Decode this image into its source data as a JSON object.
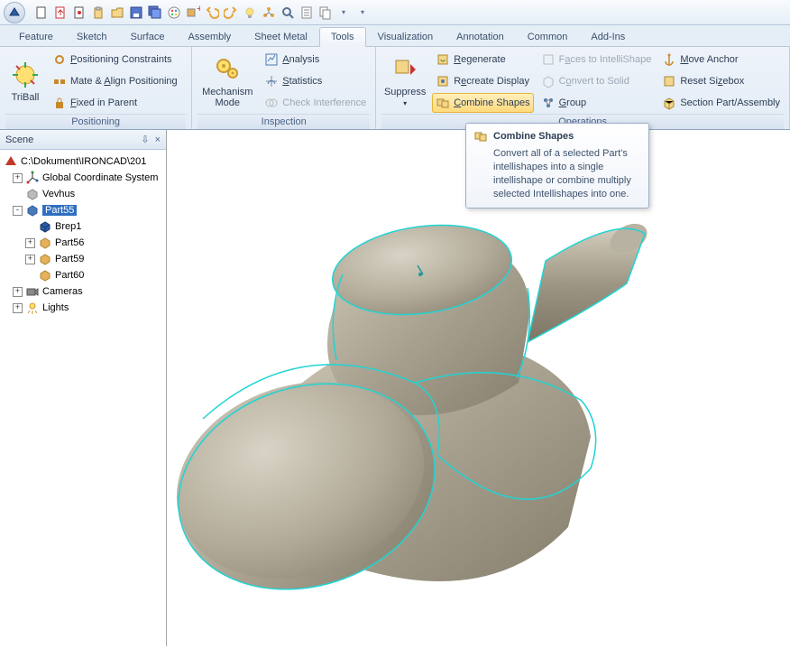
{
  "qat_icons": [
    "new",
    "open-red",
    "import",
    "clipboard",
    "folder",
    "save",
    "save-all",
    "palette",
    "block-plus",
    "undo",
    "redo",
    "bulb",
    "tree-icon",
    "find",
    "doc",
    "copy"
  ],
  "tabs": [
    "Feature",
    "Sketch",
    "Surface",
    "Assembly",
    "Sheet Metal",
    "Tools",
    "Visualization",
    "Annotation",
    "Common",
    "Add-Ins"
  ],
  "active_tab": "Tools",
  "ribbon": {
    "triball_label": "TriBall",
    "positioning": {
      "label": "Positioning",
      "items": [
        "Positioning Constraints",
        "Mate & Align Positioning",
        "Fixed in Parent"
      ]
    },
    "inspection": {
      "mechanism_label": "Mechanism Mode",
      "label": "Inspection",
      "items": [
        "Analysis",
        "Statistics",
        "Check Interference"
      ]
    },
    "suppress_label": "Suppress",
    "operations": {
      "label": "Operations",
      "col1": [
        "Regenerate",
        "Recreate Display",
        "Combine Shapes"
      ],
      "col2": [
        "Faces to IntelliShape",
        "Convert to Solid",
        "Group"
      ],
      "col3": [
        "Move Anchor",
        "Reset Sizebox",
        "Section Part/Assembly"
      ]
    }
  },
  "scene": {
    "title": "Scene",
    "root": "C:\\Dokument\\IRONCAD\\201",
    "items": [
      {
        "label": "Global Coordinate System",
        "icon": "axes",
        "exp": "+",
        "indent": 1
      },
      {
        "label": "Vevhus",
        "icon": "part-grey",
        "exp": "",
        "indent": 1
      },
      {
        "label": "Part55",
        "icon": "part-blue",
        "exp": "-",
        "indent": 1,
        "selected": true
      },
      {
        "label": "Brep1",
        "icon": "brep",
        "exp": "",
        "indent": 2
      },
      {
        "label": "Part56",
        "icon": "part-gold",
        "exp": "+",
        "indent": 2
      },
      {
        "label": "Part59",
        "icon": "part-gold",
        "exp": "+",
        "indent": 2
      },
      {
        "label": "Part60",
        "icon": "part-gold",
        "exp": "",
        "indent": 2
      },
      {
        "label": "Cameras",
        "icon": "camera",
        "exp": "+",
        "indent": 1
      },
      {
        "label": "Lights",
        "icon": "light",
        "exp": "+",
        "indent": 1
      }
    ]
  },
  "tooltip": {
    "title": "Combine Shapes",
    "body": "Convert all of a selected Part's intellishapes into a single intellishape or combine multiply selected Intellishapes into one."
  }
}
